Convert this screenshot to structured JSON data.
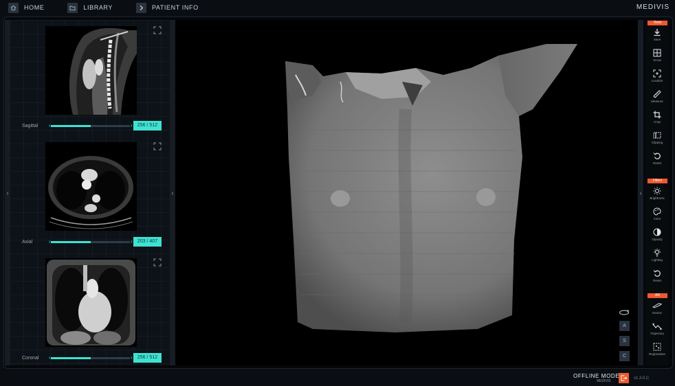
{
  "nav": {
    "items": [
      {
        "label": "HOME",
        "icon": "home-icon"
      },
      {
        "label": "LIBRARY",
        "icon": "folder-icon"
      },
      {
        "label": "PATIENT INFO",
        "icon": "chevron-right-icon"
      }
    ],
    "brand": "MEDIVIS"
  },
  "slices": [
    {
      "label": "Sagittal",
      "counter": "256 / 512",
      "position_fraction": 0.5
    },
    {
      "label": "Axial",
      "counter": "203 / 407",
      "position_fraction": 0.5
    },
    {
      "label": "Coronal",
      "counter": "256 / 512",
      "position_fraction": 0.5
    }
  ],
  "viewport": {
    "orientation_buttons": [
      "A",
      "S",
      "C"
    ],
    "rotate_icon": "rotate-icon"
  },
  "toolbar": {
    "sections": [
      {
        "tag": "Tools",
        "tools": [
          {
            "label": "Save",
            "icon": "download-icon"
          },
          {
            "label": "Scout",
            "icon": "scout-icon"
          },
          {
            "label": "Localize",
            "icon": "localize-icon"
          },
          {
            "label": "Measure",
            "icon": "ruler-icon"
          },
          {
            "label": "Crop",
            "icon": "crop-icon"
          },
          {
            "label": "Clipping",
            "icon": "clipping-icon"
          },
          {
            "label": "Reset",
            "icon": "reset-icon"
          }
        ]
      },
      {
        "tag": "Filters",
        "tools": [
          {
            "label": "Brightness",
            "icon": "brightness-icon"
          },
          {
            "label": "Color",
            "icon": "palette-icon"
          },
          {
            "label": "Opacity",
            "icon": "opacity-icon"
          },
          {
            "label": "Lighting",
            "icon": "lighting-icon"
          },
          {
            "label": "Reset",
            "icon": "reset-icon"
          }
        ]
      },
      {
        "tag": "AR",
        "tools": [
          {
            "label": "Device",
            "icon": "device-icon"
          },
          {
            "label": "Trajectory",
            "icon": "trajectory-icon"
          },
          {
            "label": "Registration",
            "icon": "registration-icon"
          }
        ]
      }
    ]
  },
  "footer": {
    "status": "OFFLINE MODE",
    "sub": "MEDIVIS",
    "version": "v1.3.0.C",
    "exit_icon": "exit-icon"
  },
  "colors": {
    "accent_cyan": "#3fe2d2",
    "accent_orange": "#ee5a2f",
    "background": "#0b0f13"
  }
}
